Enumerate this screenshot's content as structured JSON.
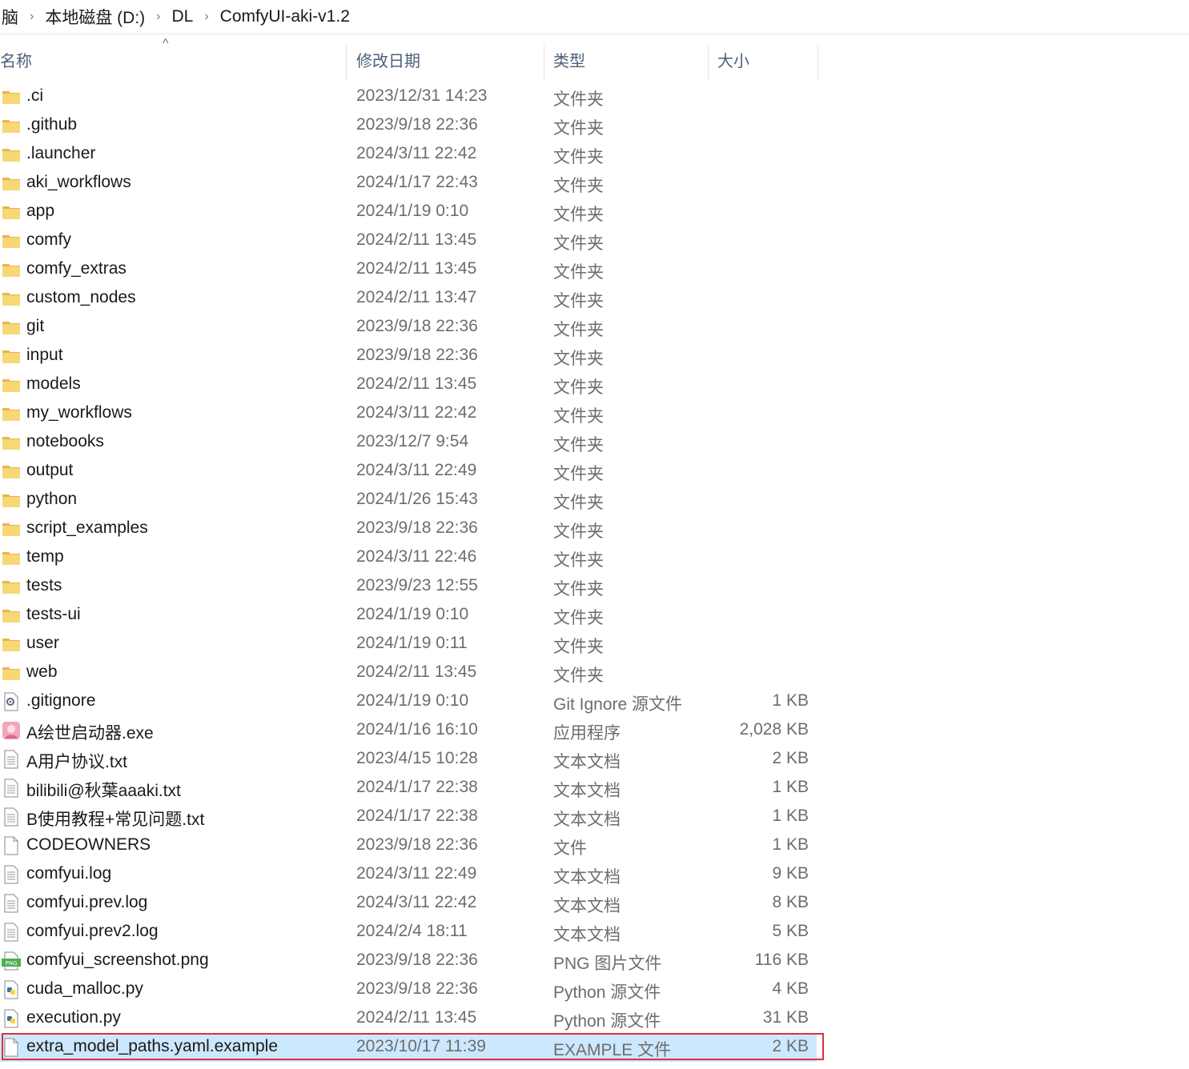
{
  "breadcrumb": {
    "cut_text": "脑",
    "items": [
      "本地磁盘 (D:)",
      "DL",
      "ComfyUI-aki-v1.2"
    ],
    "separator": "›"
  },
  "columns": {
    "name": "名称",
    "date": "修改日期",
    "type": "类型",
    "size": "大小",
    "sort_indicator": "^"
  },
  "colors": {
    "folder": "#f8d775",
    "selected_bg": "#cce8ff",
    "highlight_border": "#e0303a"
  },
  "files": [
    {
      "name": ".ci",
      "date": "2023/12/31 14:23",
      "type": "文件夹",
      "size": "",
      "icon": "folder-icon"
    },
    {
      "name": ".github",
      "date": "2023/9/18 22:36",
      "type": "文件夹",
      "size": "",
      "icon": "folder-icon"
    },
    {
      "name": ".launcher",
      "date": "2024/3/11 22:42",
      "type": "文件夹",
      "size": "",
      "icon": "folder-icon"
    },
    {
      "name": "aki_workflows",
      "date": "2024/1/17 22:43",
      "type": "文件夹",
      "size": "",
      "icon": "folder-icon"
    },
    {
      "name": "app",
      "date": "2024/1/19 0:10",
      "type": "文件夹",
      "size": "",
      "icon": "folder-icon"
    },
    {
      "name": "comfy",
      "date": "2024/2/11 13:45",
      "type": "文件夹",
      "size": "",
      "icon": "folder-icon"
    },
    {
      "name": "comfy_extras",
      "date": "2024/2/11 13:45",
      "type": "文件夹",
      "size": "",
      "icon": "folder-icon"
    },
    {
      "name": "custom_nodes",
      "date": "2024/2/11 13:47",
      "type": "文件夹",
      "size": "",
      "icon": "folder-icon"
    },
    {
      "name": "git",
      "date": "2023/9/18 22:36",
      "type": "文件夹",
      "size": "",
      "icon": "folder-icon"
    },
    {
      "name": "input",
      "date": "2023/9/18 22:36",
      "type": "文件夹",
      "size": "",
      "icon": "folder-icon"
    },
    {
      "name": "models",
      "date": "2024/2/11 13:45",
      "type": "文件夹",
      "size": "",
      "icon": "folder-icon"
    },
    {
      "name": "my_workflows",
      "date": "2024/3/11 22:42",
      "type": "文件夹",
      "size": "",
      "icon": "folder-icon"
    },
    {
      "name": "notebooks",
      "date": "2023/12/7 9:54",
      "type": "文件夹",
      "size": "",
      "icon": "folder-icon"
    },
    {
      "name": "output",
      "date": "2024/3/11 22:49",
      "type": "文件夹",
      "size": "",
      "icon": "folder-icon"
    },
    {
      "name": "python",
      "date": "2024/1/26 15:43",
      "type": "文件夹",
      "size": "",
      "icon": "folder-icon"
    },
    {
      "name": "script_examples",
      "date": "2023/9/18 22:36",
      "type": "文件夹",
      "size": "",
      "icon": "folder-icon"
    },
    {
      "name": "temp",
      "date": "2024/3/11 22:46",
      "type": "文件夹",
      "size": "",
      "icon": "folder-icon"
    },
    {
      "name": "tests",
      "date": "2023/9/23 12:55",
      "type": "文件夹",
      "size": "",
      "icon": "folder-icon"
    },
    {
      "name": "tests-ui",
      "date": "2024/1/19 0:10",
      "type": "文件夹",
      "size": "",
      "icon": "folder-icon"
    },
    {
      "name": "user",
      "date": "2024/1/19 0:11",
      "type": "文件夹",
      "size": "",
      "icon": "folder-icon"
    },
    {
      "name": "web",
      "date": "2024/2/11 13:45",
      "type": "文件夹",
      "size": "",
      "icon": "folder-icon"
    },
    {
      "name": ".gitignore",
      "date": "2024/1/19 0:10",
      "type": "Git Ignore 源文件",
      "size": "1 KB",
      "icon": "settings-file-icon"
    },
    {
      "name": "A绘世启动器.exe",
      "date": "2024/1/16 16:10",
      "type": "应用程序",
      "size": "2,028 KB",
      "icon": "app-icon"
    },
    {
      "name": "A用户协议.txt",
      "date": "2023/4/15 10:28",
      "type": "文本文档",
      "size": "2 KB",
      "icon": "text-file-icon"
    },
    {
      "name": "bilibili@秋葉aaaki.txt",
      "date": "2024/1/17 22:38",
      "type": "文本文档",
      "size": "1 KB",
      "icon": "text-file-icon"
    },
    {
      "name": "B使用教程+常见问题.txt",
      "date": "2024/1/17 22:38",
      "type": "文本文档",
      "size": "1 KB",
      "icon": "text-file-icon"
    },
    {
      "name": "CODEOWNERS",
      "date": "2023/9/18 22:36",
      "type": "文件",
      "size": "1 KB",
      "icon": "blank-file-icon"
    },
    {
      "name": "comfyui.log",
      "date": "2024/3/11 22:49",
      "type": "文本文档",
      "size": "9 KB",
      "icon": "text-file-icon"
    },
    {
      "name": "comfyui.prev.log",
      "date": "2024/3/11 22:42",
      "type": "文本文档",
      "size": "8 KB",
      "icon": "text-file-icon"
    },
    {
      "name": "comfyui.prev2.log",
      "date": "2024/2/4 18:11",
      "type": "文本文档",
      "size": "5 KB",
      "icon": "text-file-icon"
    },
    {
      "name": "comfyui_screenshot.png",
      "date": "2023/9/18 22:36",
      "type": "PNG 图片文件",
      "size": "116 KB",
      "icon": "png-file-icon"
    },
    {
      "name": "cuda_malloc.py",
      "date": "2023/9/18 22:36",
      "type": "Python 源文件",
      "size": "4 KB",
      "icon": "python-file-icon"
    },
    {
      "name": "execution.py",
      "date": "2024/2/11 13:45",
      "type": "Python 源文件",
      "size": "31 KB",
      "icon": "python-file-icon"
    },
    {
      "name": "extra_model_paths.yaml.example",
      "date": "2023/10/17 11:39",
      "type": "EXAMPLE 文件",
      "size": "2 KB",
      "icon": "blank-file-icon",
      "selected": true
    }
  ]
}
